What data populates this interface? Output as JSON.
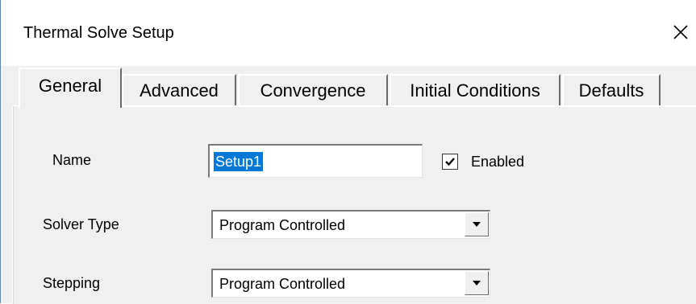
{
  "dialog": {
    "title": "Thermal Solve Setup",
    "close_glyph": "✕"
  },
  "tabs": [
    {
      "label": "General",
      "active": true
    },
    {
      "label": "Advanced",
      "active": false
    },
    {
      "label": "Convergence",
      "active": false
    },
    {
      "label": "Initial Conditions",
      "active": false
    },
    {
      "label": "Defaults",
      "active": false
    }
  ],
  "general": {
    "name_label": "Name",
    "name_value": "Setup1",
    "enabled_label": "Enabled",
    "enabled_checked": true,
    "solver_type_label": "Solver Type",
    "solver_type_value": "Program Controlled",
    "stepping_label": "Stepping",
    "stepping_value": "Program Controlled"
  },
  "icons": {
    "close": "close-icon",
    "check": "check-icon",
    "dropdown": "chevron-down-icon"
  },
  "colors": {
    "selection": "#0078d7",
    "panel_bg": "#f0f0f0",
    "window_border": "#5a8ac6"
  }
}
